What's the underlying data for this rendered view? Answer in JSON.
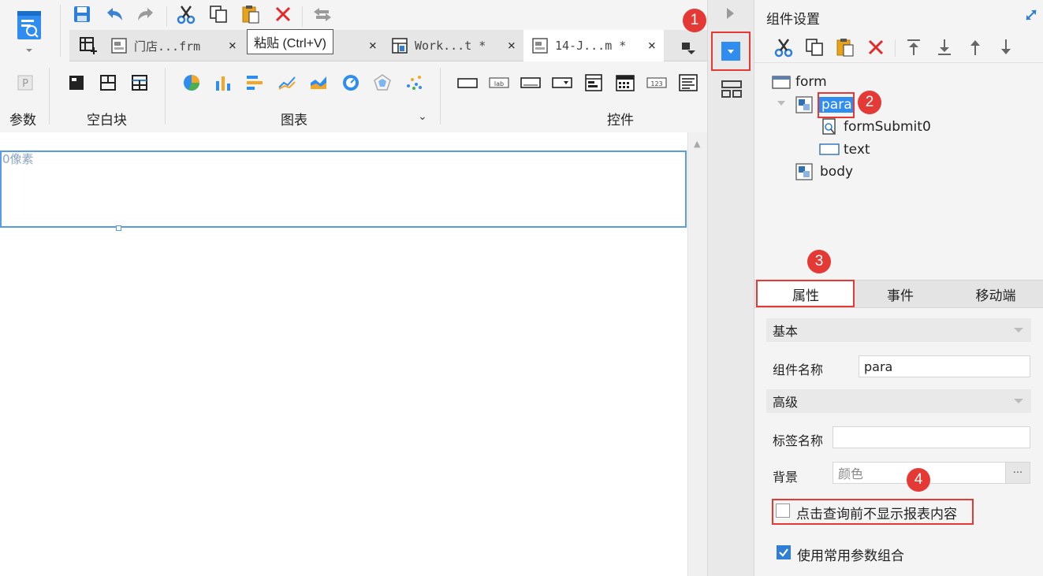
{
  "tabs": [
    {
      "label": "门店...frm",
      "close": "×"
    },
    {
      "label": "",
      "close": "×"
    },
    {
      "label": "Work...t *",
      "close": "×"
    },
    {
      "label": "14-J...m *",
      "close": "×"
    }
  ],
  "tooltip": "粘贴 (Ctrl+V)",
  "groups": {
    "param": "参数",
    "blank": "空白块",
    "chart": "图表",
    "controls": "控件"
  },
  "canvas": {
    "pixel_label": "0像素"
  },
  "right_panel": {
    "title": "组件设置",
    "tree": {
      "form": "form",
      "para": "para",
      "formSubmit": "formSubmit0",
      "text": "text",
      "body": "body"
    },
    "tabs": {
      "attributes": "属性",
      "events": "事件",
      "mobile": "移动端"
    },
    "sections": {
      "basic": "基本",
      "advanced": "高级"
    },
    "fields": {
      "component_name_label": "组件名称",
      "component_name_value": "para",
      "tag_name_label": "标签名称",
      "tag_name_value": "",
      "background_label": "背景",
      "background_value": "颜色",
      "background_more": "···"
    },
    "checkboxes": {
      "hide_before_query": {
        "label": "点击查询前不显示报表内容",
        "checked": false
      },
      "use_common_params": {
        "label": "使用常用参数组合",
        "checked": true
      }
    }
  },
  "badges": [
    "1",
    "2",
    "3",
    "4"
  ],
  "colors": {
    "accent_blue": "#2f8cf0",
    "highlight_red": "#e53935",
    "delete_red": "#e32a2a"
  }
}
